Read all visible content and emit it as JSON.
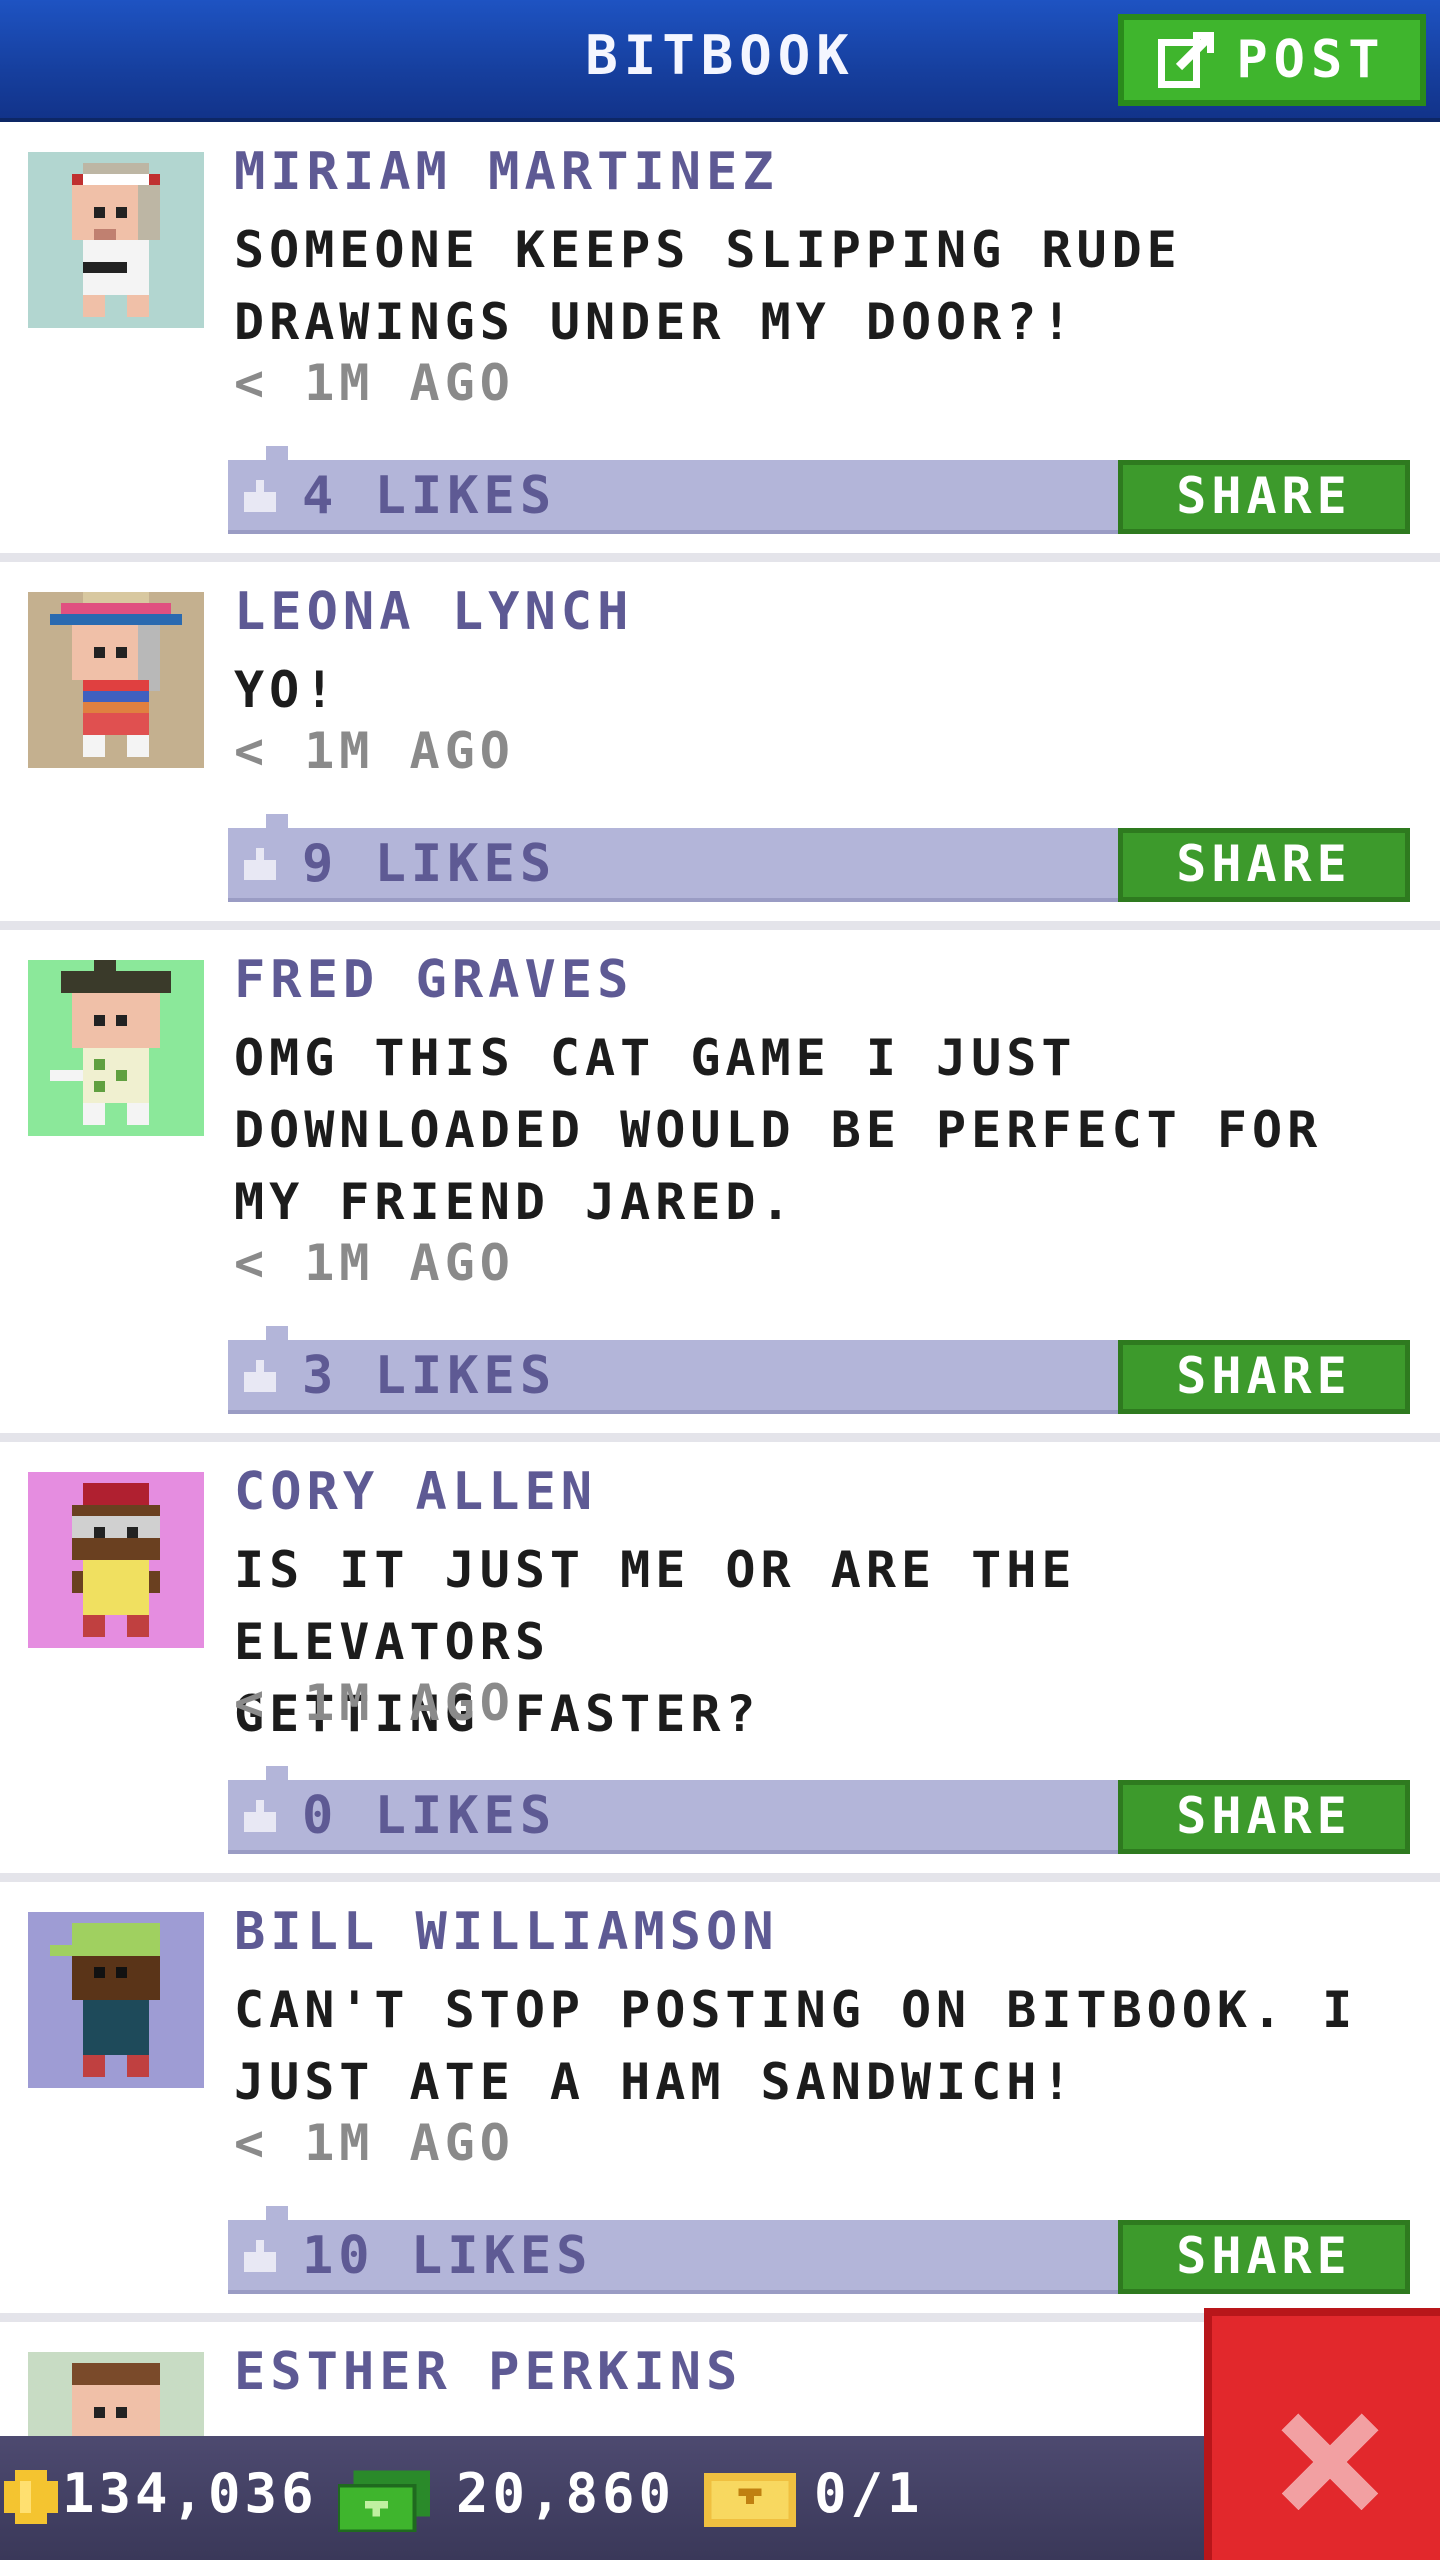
{
  "app": {
    "title": "BITBOOK",
    "post_label": "POST"
  },
  "posts": [
    {
      "name": "MIRIAM MARTINEZ",
      "message": "SOMEONE KEEPS SLIPPING RUDE\nDRAWINGS UNDER MY DOOR?!",
      "time": "< 1M AGO",
      "likes": "4 LIKES",
      "share": "SHARE",
      "avatar_bg": "#b2d6d0"
    },
    {
      "name": "LEONA LYNCH",
      "message": "YO!",
      "time": "< 1M AGO",
      "likes": "9 LIKES",
      "share": "SHARE",
      "avatar_bg": "#c4b08f"
    },
    {
      "name": "FRED GRAVES",
      "message": "OMG THIS CAT GAME I JUST\nDOWNLOADED WOULD BE PERFECT FOR\nMY FRIEND JARED.",
      "time": "< 1M AGO",
      "likes": "3 LIKES",
      "share": "SHARE",
      "avatar_bg": "#8be89a"
    },
    {
      "name": "CORY ALLEN",
      "message": "IS IT JUST ME OR ARE THE ELEVATORS\nGETTING FASTER?",
      "time": "< 1M AGO",
      "likes": "0 LIKES",
      "share": "SHARE",
      "avatar_bg": "#e58de0"
    },
    {
      "name": "BILL WILLIAMSON",
      "message": "CAN'T STOP POSTING ON BITBOOK. I\nJUST ATE A HAM SANDWICH!",
      "time": "< 1M AGO",
      "likes": "10 LIKES",
      "share": "SHARE",
      "avatar_bg": "#9e9cd4"
    },
    {
      "name": "ESTHER PERKINS",
      "avatar_bg": "#c8dcc4"
    }
  ],
  "status": {
    "coins": "134,036",
    "bux": "20,860",
    "tickets": "0/1"
  },
  "colors": {
    "accent": "#1e53c2",
    "share_green": "#3d9a2c",
    "likes_bar": "#b3b5d9",
    "close_red": "#e2282c"
  },
  "icons": {
    "post": "edit-icon",
    "like": "thumb-up-icon",
    "close": "close-icon",
    "coin": "coin-icon",
    "bux": "cash-icon",
    "ticket": "ticket-icon"
  }
}
